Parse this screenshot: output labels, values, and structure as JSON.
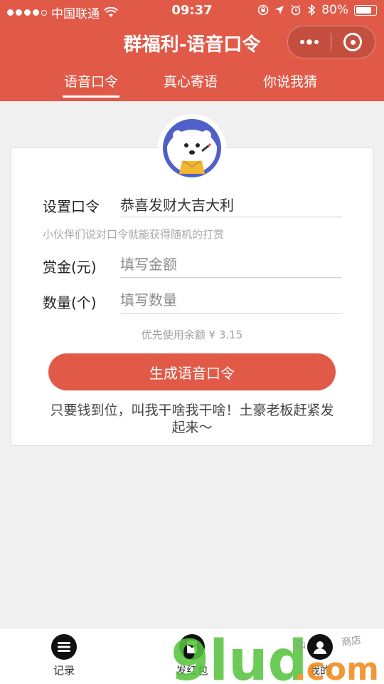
{
  "status_bar": {
    "carrier": "中国联通",
    "time": "09:37",
    "battery_percent": "80%",
    "battery_level": 0.8
  },
  "header": {
    "title": "群福利-语音口令"
  },
  "tabs": [
    {
      "label": "语音口令",
      "active": true
    },
    {
      "label": "真心寄语",
      "active": false
    },
    {
      "label": "你说我猜",
      "active": false
    }
  ],
  "form": {
    "command_label": "设置口令",
    "command_value": "恭喜发财大吉大利",
    "hint": "小伙伴们说对口令就能获得随机的打赏",
    "amount_label": "赏金(元)",
    "amount_placeholder": "填写金额",
    "count_label": "数量(个)",
    "count_placeholder": "填写数量",
    "balance_text": "优先使用余额 ¥ 3.15",
    "submit_label": "生成语音口令",
    "slogan": "只要钱到位，叫我干啥我干啥！土豪老板赶紧发起来～"
  },
  "bottom_nav": [
    {
      "label": "记录",
      "icon": "list-icon"
    },
    {
      "label": "发红包",
      "icon": "red-packet-icon"
    },
    {
      "label": "我的",
      "icon": "user-icon"
    }
  ],
  "watermark": {
    "text": "9lud.com",
    "small_text": "山 商店"
  },
  "colors": {
    "brand": "#e15a48",
    "background": "#f0f0f0",
    "watermark_green": "#57c43f",
    "watermark_orange": "#f08a1c"
  }
}
